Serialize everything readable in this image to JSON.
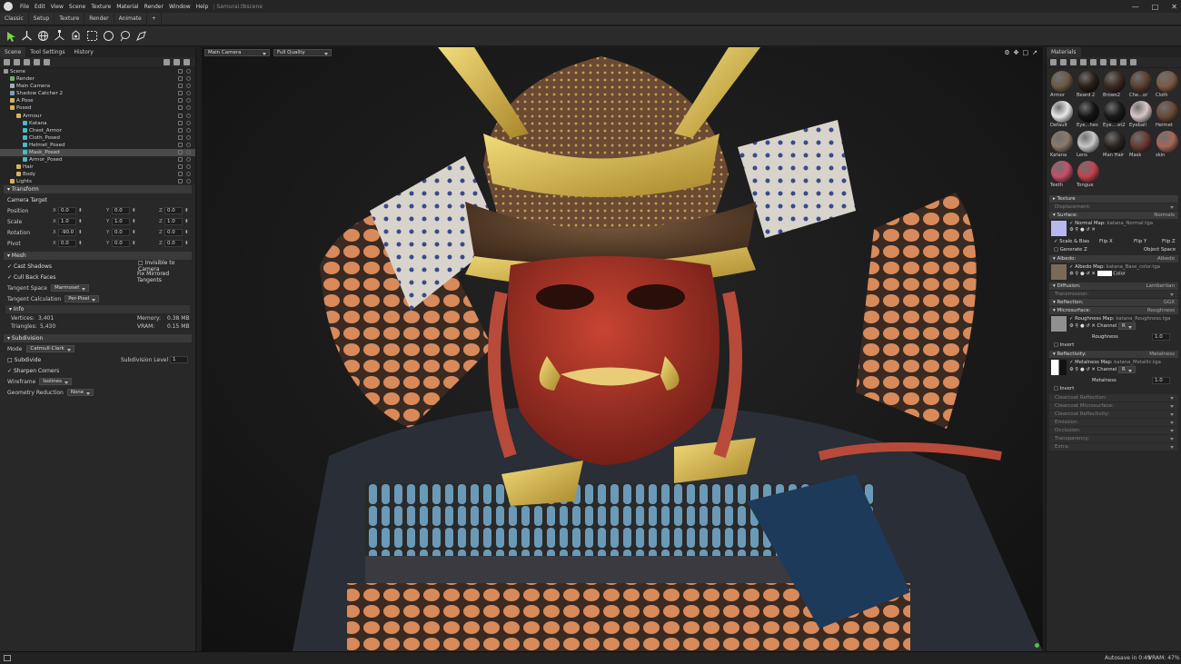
{
  "app": {
    "menu": [
      "File",
      "Edit",
      "View",
      "Scene",
      "Texture",
      "Material",
      "Render",
      "Window",
      "Help"
    ],
    "title": "Samurai.tbscene"
  },
  "tabs": [
    "Classic",
    "Setup",
    "Texture",
    "Render",
    "Animate",
    "+"
  ],
  "toolbar_icons": [
    "select-arrow-icon",
    "transform-gizmo-icon",
    "rotate-icon",
    "scale-icon",
    "lasso-select-icon",
    "rect-select-icon",
    "circle-select-icon",
    "lasso-icon",
    "paint-select-icon"
  ],
  "left_panel": {
    "tabs": [
      "Scene",
      "Tool Settings",
      "History"
    ],
    "tree": [
      {
        "label": "Scene",
        "indent": 0,
        "color": "#9a9a9a"
      },
      {
        "label": "Render",
        "indent": 1,
        "color": "#6bb36b"
      },
      {
        "label": "Main Camera",
        "indent": 1,
        "color": "#9ab0c8"
      },
      {
        "label": "Shadow Catcher 2",
        "indent": 1,
        "color": "#7fa0c0"
      },
      {
        "label": "A Pose",
        "indent": 1,
        "color": "#d8b45a"
      },
      {
        "label": "Posed",
        "indent": 1,
        "color": "#d8b45a"
      },
      {
        "label": "Armour",
        "indent": 2,
        "color": "#d8b45a"
      },
      {
        "label": "Katana",
        "indent": 3,
        "color": "#4fb7c7"
      },
      {
        "label": "Chest_Armor",
        "indent": 3,
        "color": "#4fb7c7"
      },
      {
        "label": "Cloth_Posed",
        "indent": 3,
        "color": "#4fb7c7"
      },
      {
        "label": "Helmet_Posed",
        "indent": 3,
        "color": "#4fb7c7"
      },
      {
        "label": "Mask_Posed",
        "indent": 3,
        "color": "#4fb7c7",
        "selected": true
      },
      {
        "label": "Armor_Posed",
        "indent": 3,
        "color": "#4fb7c7"
      },
      {
        "label": "Hair",
        "indent": 2,
        "color": "#d8b45a"
      },
      {
        "label": "Body",
        "indent": 2,
        "color": "#d8b45a"
      },
      {
        "label": "Lights",
        "indent": 1,
        "color": "#d8b45a"
      }
    ],
    "transform": {
      "header": "Transform",
      "camera_target": "Camera Target",
      "rows": [
        {
          "label": "Position",
          "x": "0.0",
          "y": "0.0",
          "z": "0.0"
        },
        {
          "label": "Scale",
          "x": "1.0",
          "y": "1.0",
          "z": "1.0"
        },
        {
          "label": "Rotation",
          "x": "-90.0",
          "y": "0.0",
          "z": "0.0"
        },
        {
          "label": "Pivot",
          "x": "0.0",
          "y": "0.0",
          "z": "0.0"
        }
      ]
    },
    "mesh": {
      "header": "Mesh",
      "cast_shadows": "Cast Shadows",
      "invisible_to_camera": "Invisible to Camera",
      "cull_back_faces": "Cull Back Faces",
      "fix_mirrored": "Fix Mirrored Tangents",
      "tangent_space_label": "Tangent Space",
      "tangent_space_value": "Marmoset",
      "tangent_calc_label": "Tangent Calculation",
      "tangent_calc_value": "Per-Pixel",
      "info_header": "Info",
      "vertices_label": "Vertices:",
      "vertices_value": "3,401",
      "triangles_label": "Triangles:",
      "triangles_value": "5,430",
      "memory_label": "Memory:",
      "memory_value": "0.38 MB",
      "vram_label": "VRAM:",
      "vram_value": "0.15 MB"
    },
    "subdivision": {
      "header": "Subdivision",
      "mode_label": "Mode",
      "mode_value": "Catmull-Clark",
      "subdivide": "Subdivide",
      "level_label": "Subdivision Level",
      "level_value": "1",
      "sharpen": "Sharpen Corners",
      "wireframe_label": "Wireframe",
      "wireframe_value": "Isolines",
      "geo_label": "Geometry Reduction",
      "geo_value": "None"
    }
  },
  "viewport": {
    "camera": "Main Camera",
    "quality": "Full Quality"
  },
  "right_panel": {
    "header": "Materials",
    "materials": [
      {
        "name": "Armor",
        "c": "#6b5a46"
      },
      {
        "name": "Beard 2",
        "c": "#2a1e18"
      },
      {
        "name": "Brows2",
        "c": "#3a2a20"
      },
      {
        "name": "Che...or",
        "c": "#5a4030"
      },
      {
        "name": "Cloth",
        "c": "#7a5a44"
      },
      {
        "name": "Default",
        "c": "#e8e8e8"
      },
      {
        "name": "Eye...hes",
        "c": "#151515"
      },
      {
        "name": "Eye....et2",
        "c": "#1a1a1a"
      },
      {
        "name": "Eyeball",
        "c": "#d8c8c8"
      },
      {
        "name": "Helmet",
        "c": "#6a4a38"
      },
      {
        "name": "Katana",
        "c": "#8a7a6a"
      },
      {
        "name": "Lens",
        "c": "#c8c8c8"
      },
      {
        "name": "Man Hair",
        "c": "#2a2420"
      },
      {
        "name": "Mask",
        "c": "#6a3a34"
      },
      {
        "name": "skin",
        "c": "#a8665a"
      },
      {
        "name": "Teeth",
        "c": "#c4506a"
      },
      {
        "name": "Tongue",
        "c": "#c04450"
      }
    ],
    "texture": "Texture",
    "displacement": "Displacement:",
    "surface": {
      "label": "Surface:",
      "value": "Normals"
    },
    "normal_map_label": "Normal Map:",
    "normal_map_file": "katana_Normal.tga",
    "scale_bias": "Scale & Bias",
    "flip_x": "Flip X",
    "flip_y": "Flip Y",
    "flip_z": "Flip Z",
    "generate_z": "Generate Z",
    "object_space": "Object Space",
    "albedo": {
      "label": "Albedo:",
      "value": "Albedo"
    },
    "albedo_map_label": "Albedo Map:",
    "albedo_map_file": "katana_Base_color.tga",
    "color_label": "Color",
    "diffusion": {
      "label": "Diffusion:",
      "value": "Lambertian"
    },
    "transmission": "Transmission:",
    "reflection": {
      "label": "Reflection:",
      "value": "GGX"
    },
    "microsurface": {
      "label": "Microsurface:",
      "value": "Roughness"
    },
    "roughness_map_label": "Roughness Map:",
    "roughness_map_file": "katana_Roughness.tga",
    "channel_label": "Channel",
    "channel_value": "R",
    "roughness_label": "Roughness",
    "roughness_value": "1.0",
    "invert": "Invert",
    "reflectivity": {
      "label": "Reflectivity:",
      "value": "Metalness"
    },
    "metal_map_label": "Metalness Map:",
    "metal_map_file": "katana_Metallic.tga",
    "metalness_label": "Metalness",
    "metalness_value": "1.0",
    "dim_sections": [
      "Clearcoat Reflection:",
      "Clearcoat Microsurface:",
      "Clearcoat Reflectivity:",
      "Emission:",
      "Occlusion:",
      "Transparency:",
      "Extra:"
    ]
  },
  "status": {
    "autosave": "Autosave in 0:49",
    "vram": "VRAM: 47%"
  }
}
